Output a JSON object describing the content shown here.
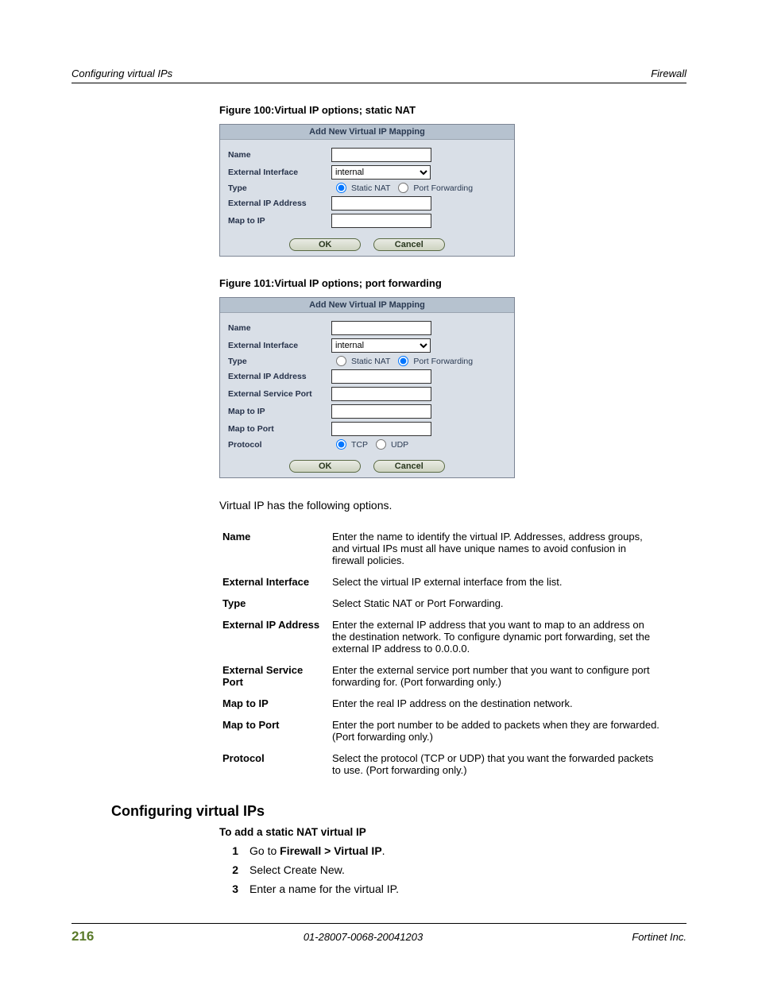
{
  "header": {
    "left": "Configuring virtual IPs",
    "right": "Firewall"
  },
  "fig100": {
    "caption": "Figure 100:Virtual IP options; static NAT",
    "title": "Add New Virtual IP Mapping",
    "rows": {
      "name": "Name",
      "extif": "External Interface",
      "type": "Type",
      "extip": "External IP Address",
      "mapip": "Map to IP"
    },
    "extif_value": "internal",
    "radios": {
      "static": "Static NAT",
      "portfwd": "Port Forwarding"
    },
    "ok": "OK",
    "cancel": "Cancel"
  },
  "fig101": {
    "caption": "Figure 101:Virtual IP options; port forwarding",
    "title": "Add New Virtual IP Mapping",
    "rows": {
      "name": "Name",
      "extif": "External Interface",
      "type": "Type",
      "extip": "External IP Address",
      "extport": "External Service Port",
      "mapip": "Map to IP",
      "mapport": "Map to Port",
      "proto": "Protocol"
    },
    "extif_value": "internal",
    "radios": {
      "static": "Static NAT",
      "portfwd": "Port Forwarding",
      "tcp": "TCP",
      "udp": "UDP"
    },
    "ok": "OK",
    "cancel": "Cancel"
  },
  "intro": "Virtual IP has the following options.",
  "opts": [
    {
      "k": "Name",
      "v": "Enter the name to identify the virtual IP. Addresses, address groups, and virtual IPs must all have unique names to avoid confusion in firewall policies."
    },
    {
      "k": "External Interface",
      "v": "Select the virtual IP external interface from the list."
    },
    {
      "k": "Type",
      "v": "Select Static NAT or Port Forwarding."
    },
    {
      "k": "External IP Address",
      "v": "Enter the external IP address that you want to map to an address on the destination network. To configure dynamic port forwarding, set the external IP address to 0.0.0.0."
    },
    {
      "k": "External Service Port",
      "v": "Enter the external service port number that you want to configure port forwarding for. (Port forwarding only.)"
    },
    {
      "k": "Map to IP",
      "v": "Enter the real IP address on the destination network."
    },
    {
      "k": "Map to Port",
      "v": "Enter the port number to be added to packets when they are forwarded. (Port forwarding only.)"
    },
    {
      "k": "Protocol",
      "v": "Select the protocol (TCP or UDP) that you want the forwarded packets to use. (Port forwarding only.)"
    }
  ],
  "section": "Configuring virtual IPs",
  "subhead": "To add a static NAT virtual IP",
  "steps": {
    "s1_pre": "Go to ",
    "s1_bold": "Firewall > Virtual IP",
    "s1_post": ".",
    "s2": "Select Create New.",
    "s3": "Enter a name for the virtual IP."
  },
  "footer": {
    "page": "216",
    "docid": "01-28007-0068-20041203",
    "company": "Fortinet Inc."
  }
}
